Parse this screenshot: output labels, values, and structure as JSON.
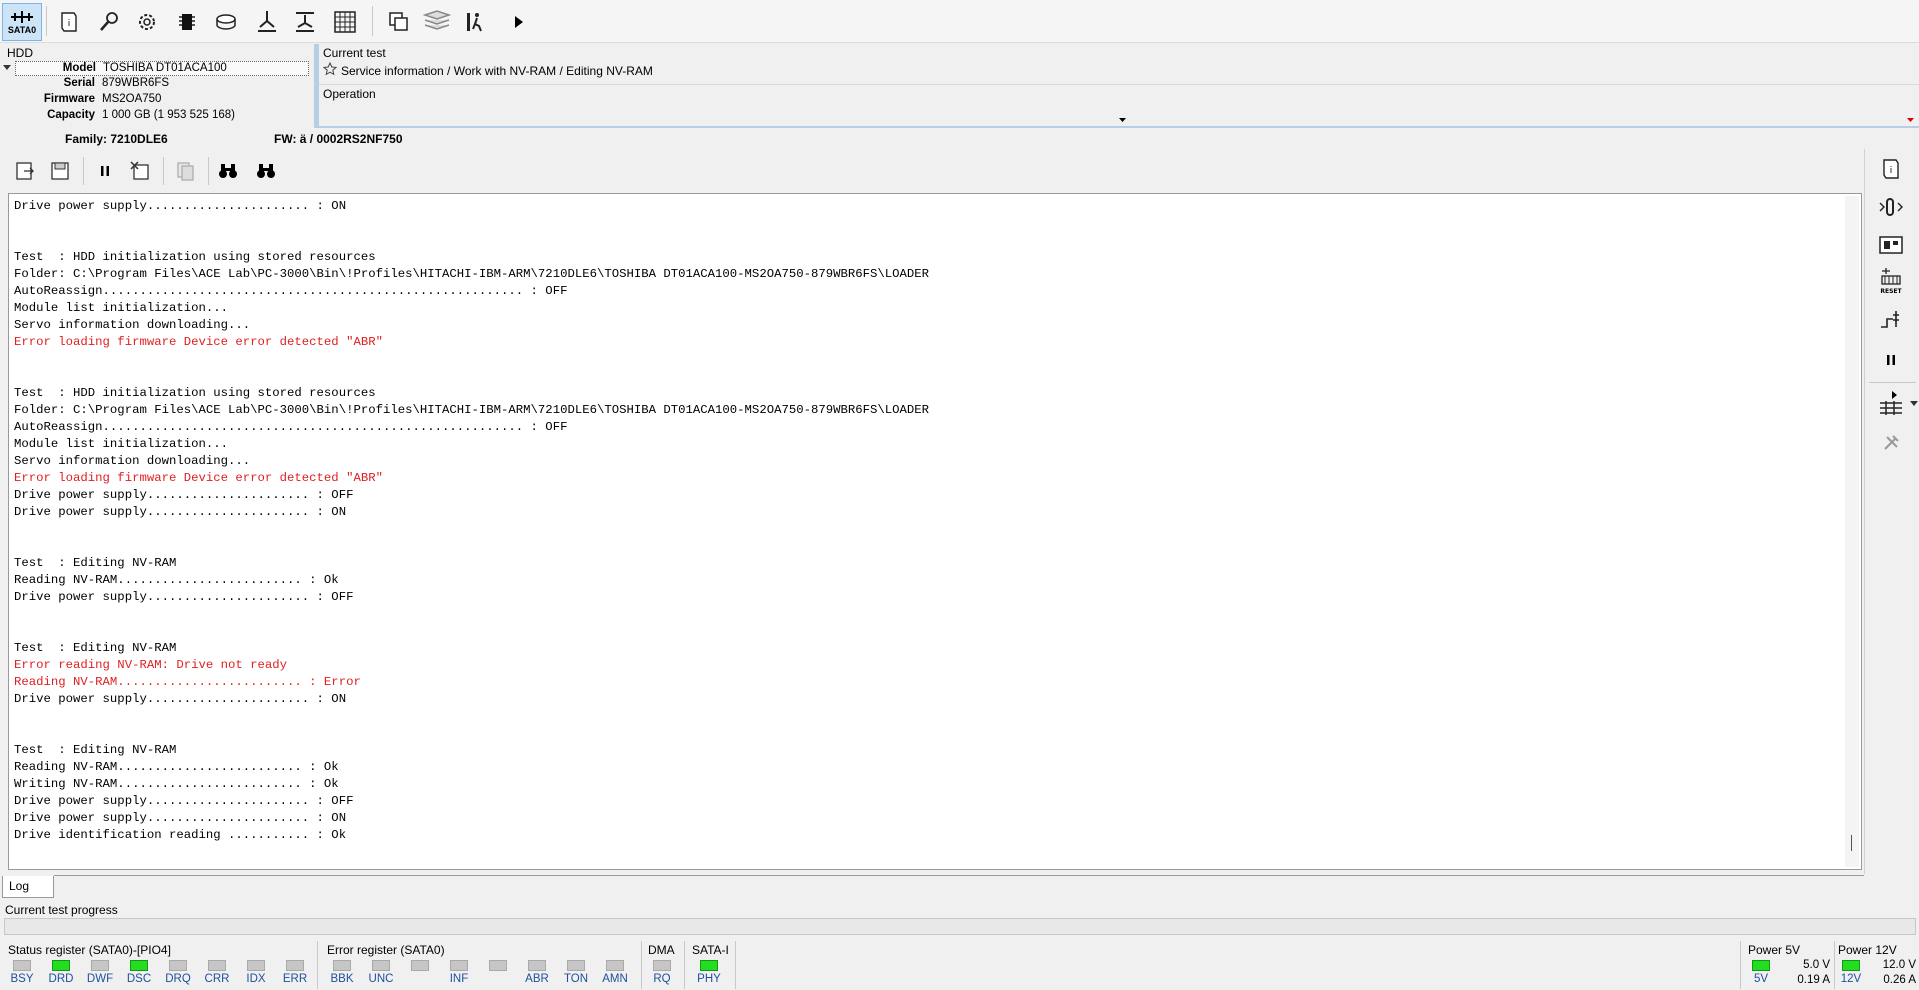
{
  "toolbar": {
    "sata_label": "SATA0",
    "icons": [
      "sata-port",
      "info-scroll",
      "probe",
      "gear-cog",
      "chip",
      "drive",
      "heads",
      "tracks",
      "grid",
      "windows",
      "database",
      "runner",
      "play"
    ]
  },
  "hdd": {
    "title": "HDD",
    "rows": [
      {
        "label": "Model",
        "value": "TOSHIBA DT01ACA100"
      },
      {
        "label": "Serial",
        "value": "879WBR6FS"
      },
      {
        "label": "Firmware",
        "value": "MS2OA750"
      },
      {
        "label": "Capacity",
        "value": "1 000 GB (1 953 525 168)"
      }
    ]
  },
  "current_test": {
    "label": "Current test",
    "path": "Service information / Work with NV-RAM / Editing NV-RAM",
    "operation_label": "Operation"
  },
  "family": {
    "family_text": "Family: 7210DLE6",
    "fw_text": "FW: ä  / 0002RS2NF750"
  },
  "log": {
    "lines": [
      {
        "text": "Drive power supply...................... : ON",
        "error": false
      },
      {
        "text": "",
        "error": false
      },
      {
        "text": "",
        "error": false
      },
      {
        "text": "Test  : HDD initialization using stored resources",
        "error": false
      },
      {
        "text": "Folder: C:\\Program Files\\ACE Lab\\PC-3000\\Bin\\!Profiles\\HITACHI-IBM-ARM\\7210DLE6\\TOSHIBA DT01ACA100-MS2OA750-879WBR6FS\\LOADER",
        "error": false
      },
      {
        "text": "AutoReassign......................................................... : OFF",
        "error": false
      },
      {
        "text": "Module list initialization...",
        "error": false
      },
      {
        "text": "Servo information downloading...",
        "error": false
      },
      {
        "text": "Error loading firmware Device error detected \"ABR\"",
        "error": true
      },
      {
        "text": "",
        "error": false
      },
      {
        "text": "",
        "error": false
      },
      {
        "text": "Test  : HDD initialization using stored resources",
        "error": false
      },
      {
        "text": "Folder: C:\\Program Files\\ACE Lab\\PC-3000\\Bin\\!Profiles\\HITACHI-IBM-ARM\\7210DLE6\\TOSHIBA DT01ACA100-MS2OA750-879WBR6FS\\LOADER",
        "error": false
      },
      {
        "text": "AutoReassign......................................................... : OFF",
        "error": false
      },
      {
        "text": "Module list initialization...",
        "error": false
      },
      {
        "text": "Servo information downloading...",
        "error": false
      },
      {
        "text": "Error loading firmware Device error detected \"ABR\"",
        "error": true
      },
      {
        "text": "Drive power supply...................... : OFF",
        "error": false
      },
      {
        "text": "Drive power supply...................... : ON",
        "error": false
      },
      {
        "text": "",
        "error": false
      },
      {
        "text": "",
        "error": false
      },
      {
        "text": "Test  : Editing NV-RAM",
        "error": false
      },
      {
        "text": "Reading NV-RAM......................... : Ok",
        "error": false
      },
      {
        "text": "Drive power supply...................... : OFF",
        "error": false
      },
      {
        "text": "",
        "error": false
      },
      {
        "text": "",
        "error": false
      },
      {
        "text": "Test  : Editing NV-RAM",
        "error": false
      },
      {
        "text": "Error reading NV-RAM: Drive not ready",
        "error": true
      },
      {
        "text": "Reading NV-RAM......................... : Error",
        "error": true
      },
      {
        "text": "Drive power supply...................... : ON",
        "error": false
      },
      {
        "text": "",
        "error": false
      },
      {
        "text": "",
        "error": false
      },
      {
        "text": "Test  : Editing NV-RAM",
        "error": false
      },
      {
        "text": "Reading NV-RAM......................... : Ok",
        "error": false
      },
      {
        "text": "Writing NV-RAM......................... : Ok",
        "error": false
      },
      {
        "text": "Drive power supply...................... : OFF",
        "error": false
      },
      {
        "text": "Drive power supply...................... : ON",
        "error": false
      },
      {
        "text": "Drive identification reading ........... : Ok",
        "error": false
      }
    ],
    "tab_label": "Log"
  },
  "progress": {
    "label": "Current test progress",
    "value": 0
  },
  "status_register": {
    "title": "Status register (SATA0)-[PIO4]",
    "leds": [
      {
        "label": "BSY",
        "on": false
      },
      {
        "label": "DRD",
        "on": true
      },
      {
        "label": "DWF",
        "on": false
      },
      {
        "label": "DSC",
        "on": true
      },
      {
        "label": "DRQ",
        "on": false
      },
      {
        "label": "CRR",
        "on": false
      },
      {
        "label": "IDX",
        "on": false
      },
      {
        "label": "ERR",
        "on": false
      }
    ]
  },
  "error_register": {
    "title": "Error register (SATA0)",
    "leds": [
      {
        "label": "BBK",
        "on": false
      },
      {
        "label": "UNC",
        "on": false
      },
      {
        "label": "",
        "on": false
      },
      {
        "label": "INF",
        "on": false
      },
      {
        "label": "",
        "on": false
      },
      {
        "label": "ABR",
        "on": false
      },
      {
        "label": "TON",
        "on": false
      },
      {
        "label": "AMN",
        "on": false
      }
    ]
  },
  "dma": {
    "title": "DMA",
    "leds": [
      {
        "label": "RQ",
        "on": false
      }
    ]
  },
  "sata": {
    "title": "SATA-I",
    "leds": [
      {
        "label": "PHY",
        "on": true
      }
    ]
  },
  "power5v": {
    "title": "Power 5V",
    "led_label": "5V",
    "on": true,
    "voltage": "5.0 V",
    "current": "0.19 A"
  },
  "power12v": {
    "title": "Power 12V",
    "led_label": "12V",
    "on": true,
    "voltage": "12.0 V",
    "current": "0.26 A"
  }
}
